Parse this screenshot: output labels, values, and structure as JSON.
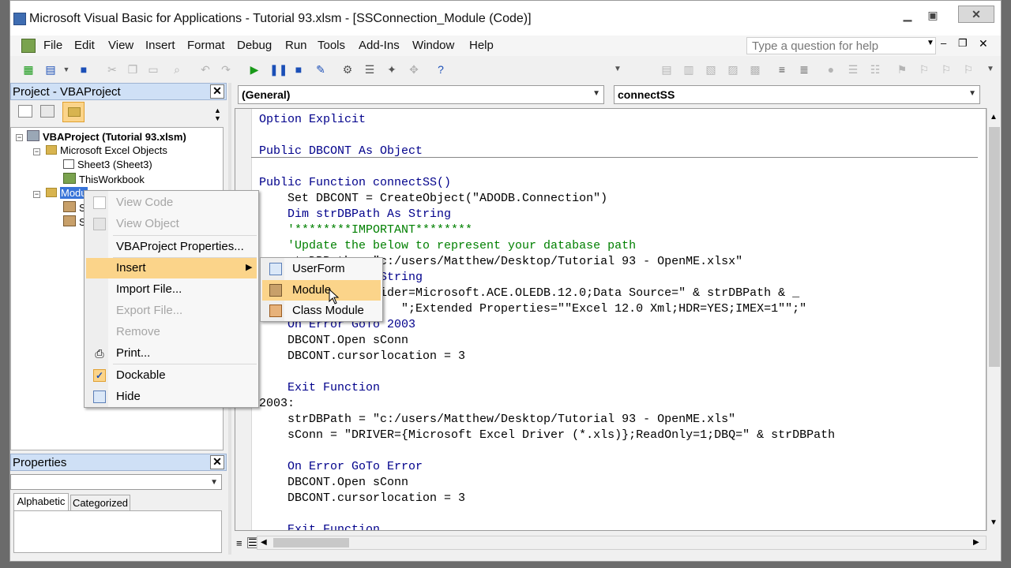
{
  "window": {
    "title": "Microsoft Visual Basic for Applications - Tutorial 93.xlsm - [SSConnection_Module (Code)]"
  },
  "menubar": {
    "items": [
      {
        "label": "File"
      },
      {
        "label": "Edit"
      },
      {
        "label": "View"
      },
      {
        "label": "Insert"
      },
      {
        "label": "Format"
      },
      {
        "label": "Debug"
      },
      {
        "label": "Run"
      },
      {
        "label": "Tools"
      },
      {
        "label": "Add-Ins"
      },
      {
        "label": "Window"
      },
      {
        "label": "Help"
      }
    ],
    "help_placeholder": "Type a question for help"
  },
  "project_panel": {
    "title": "Project - VBAProject",
    "tree": {
      "root": "VBAProject (Tutorial 93.xlsm)",
      "excel_objects": "Microsoft Excel Objects",
      "sheet3": "Sheet3 (Sheet3)",
      "thisworkbook": "ThisWorkbook",
      "modules": "Modu",
      "mod_child_1": "S",
      "mod_child_2": "S"
    }
  },
  "properties_panel": {
    "title": "Properties",
    "tab_alphabetic": "Alphabetic",
    "tab_categorized": "Categorized"
  },
  "code_window": {
    "object_combo": "(General)",
    "proc_combo": "connectSS",
    "lines": [
      {
        "text": "Option Explicit",
        "kind": "kw"
      },
      {
        "text": "",
        "kind": "tx"
      },
      {
        "text": "Public DBCONT As Object",
        "kind": "kw"
      },
      {
        "text": "",
        "kind": "tx"
      },
      {
        "text": "Public Function connectSS()",
        "kind": "kw"
      },
      {
        "text": "    Set DBCONT = CreateObject(\"ADODB.Connection\")",
        "kind": "tx"
      },
      {
        "text": "    Dim strDBPath As String",
        "kind": "kw"
      },
      {
        "text": "    '********IMPORTANT********",
        "kind": "cm"
      },
      {
        "text": "    'Update the below to represent your database path",
        "kind": "cm"
      },
      {
        "text": "    strDBPath = \"c:/users/Matthew/Desktop/Tutorial 93 - OpenME.xlsx\"",
        "kind": "tx"
      },
      {
        "text": "    Dim sConn As String",
        "kind": "kw"
      },
      {
        "text": "    sConn = \"Provider=Microsoft.ACE.OLEDB.12.0;Data Source=\" & strDBPath & _",
        "kind": "tx"
      },
      {
        "text": "                    \";Extended Properties=\"\"Excel 12.0 Xml;HDR=YES;IMEX=1\"\";\"",
        "kind": "tx"
      },
      {
        "text": "    On Error GoTo 2003",
        "kind": "kw"
      },
      {
        "text": "    DBCONT.Open sConn",
        "kind": "tx"
      },
      {
        "text": "    DBCONT.cursorlocation = 3",
        "kind": "tx"
      },
      {
        "text": "",
        "kind": "tx"
      },
      {
        "text": "    Exit Function",
        "kind": "kw"
      },
      {
        "text": "2003:",
        "kind": "tx"
      },
      {
        "text": "    strDBPath = \"c:/users/Matthew/Desktop/Tutorial 93 - OpenME.xls\"",
        "kind": "tx"
      },
      {
        "text": "    sConn = \"DRIVER={Microsoft Excel Driver (*.xls)};ReadOnly=1;DBQ=\" & strDBPath",
        "kind": "tx"
      },
      {
        "text": "",
        "kind": "tx"
      },
      {
        "text": "    On Error GoTo Error",
        "kind": "kw"
      },
      {
        "text": "    DBCONT.Open sConn",
        "kind": "tx"
      },
      {
        "text": "    DBCONT.cursorlocation = 3",
        "kind": "tx"
      },
      {
        "text": "",
        "kind": "tx"
      },
      {
        "text": "    Exit Function",
        "kind": "kw"
      }
    ]
  },
  "context_menu": {
    "view_code": "View Code",
    "view_object": "View Object",
    "vbaproject_properties": "VBAProject Properties...",
    "insert": "Insert",
    "import_file": "Import File...",
    "export_file": "Export File...",
    "remove": "Remove",
    "print": "Print...",
    "dockable": "Dockable",
    "hide": "Hide"
  },
  "insert_submenu": {
    "userform": "UserForm",
    "module": "Module",
    "class_module": "Class Module"
  },
  "colors": {
    "keyword": "#00008b",
    "comment": "#008000",
    "highlight": "#fbd48a"
  }
}
